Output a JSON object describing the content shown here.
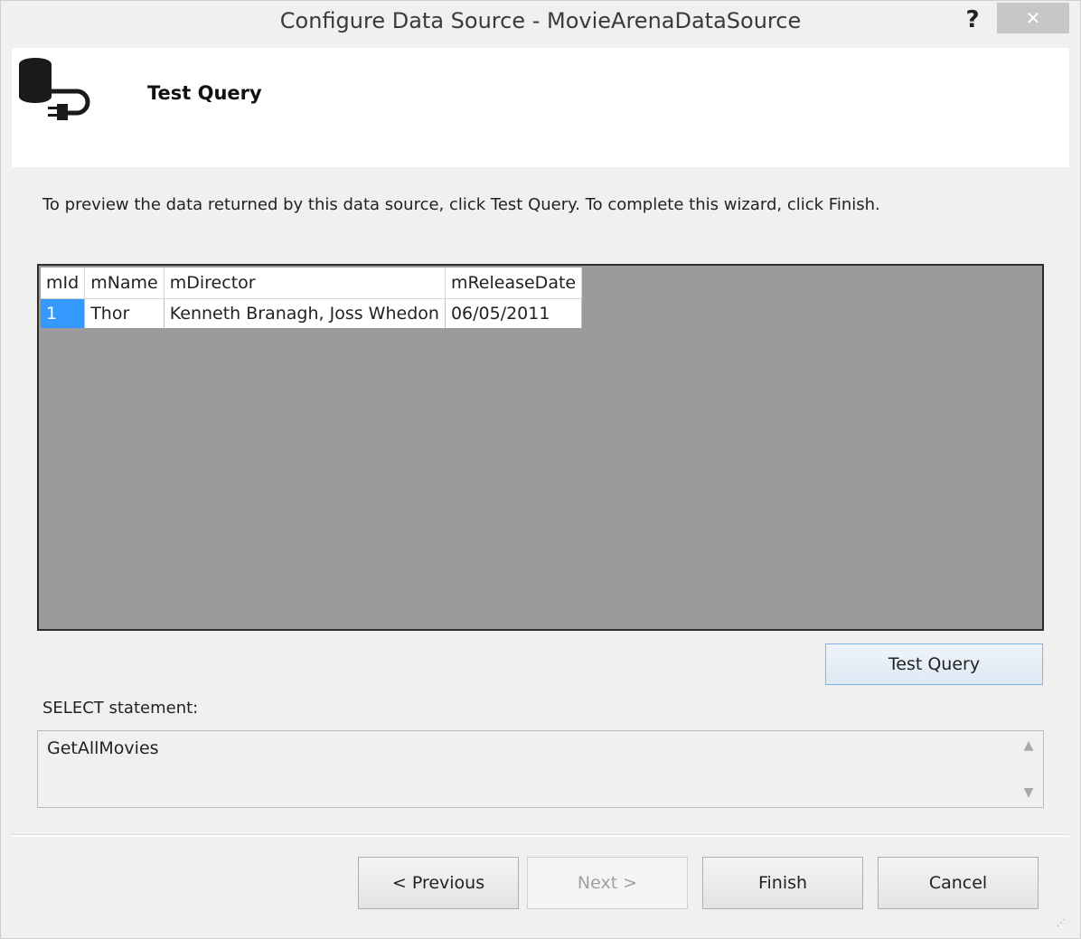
{
  "window": {
    "title": "Configure Data Source - MovieArenaDataSource",
    "help_label": "?",
    "close_label": "✕"
  },
  "header": {
    "title": "Test Query",
    "icon": "database-plug-icon"
  },
  "instructions": "To preview the data returned by this data source, click Test Query. To complete this wizard, click Finish.",
  "results": {
    "columns": [
      "mId",
      "mName",
      "mDirector",
      "mReleaseDate"
    ],
    "rows": [
      {
        "mId": "1",
        "mName": "Thor",
        "mDirector": "Kenneth Branagh, Joss Whedon",
        "mReleaseDate": "06/05/2011"
      }
    ]
  },
  "test_query_label": "Test Query",
  "select_statement": {
    "label": "SELECT statement:",
    "value": "GetAllMovies"
  },
  "buttons": {
    "previous": "< Previous",
    "next": "Next >",
    "finish": "Finish",
    "cancel": "Cancel"
  },
  "colors": {
    "selection": "#3399ff",
    "grid_background": "#9b9b9b"
  }
}
